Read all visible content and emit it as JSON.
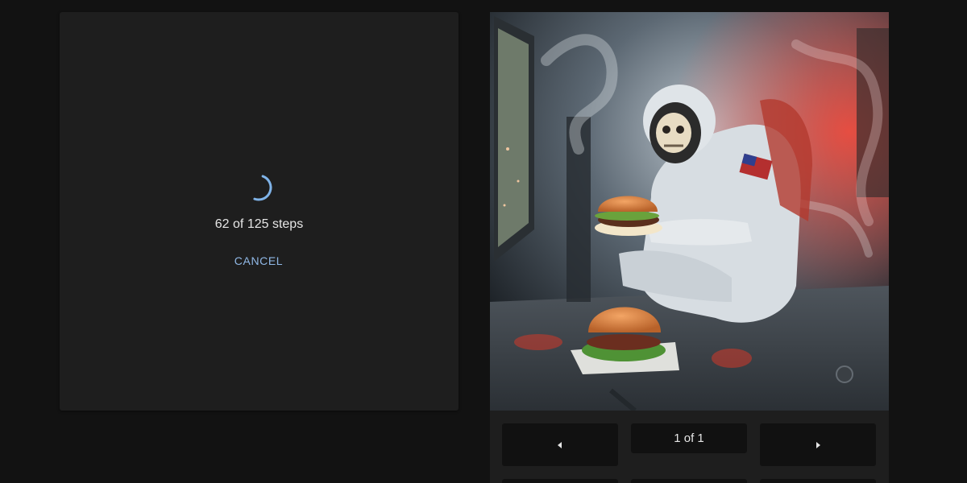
{
  "progress": {
    "steps_text": "62 of 125 steps",
    "current_step": 62,
    "total_steps": 125,
    "cancel_label": "CANCEL"
  },
  "viewer": {
    "image_alt": "Skeleton astronaut holding a burger inside a smoky spaceship, with another burger on the floor",
    "page_indicator": "1 of 1",
    "prev_icon": "caret-left-icon",
    "next_icon": "caret-right-icon"
  },
  "colors": {
    "background": "#121212",
    "card": "#1e1e1e",
    "button": "#111111",
    "accent": "#90b8e6",
    "spinner": "#7fb3e8"
  }
}
